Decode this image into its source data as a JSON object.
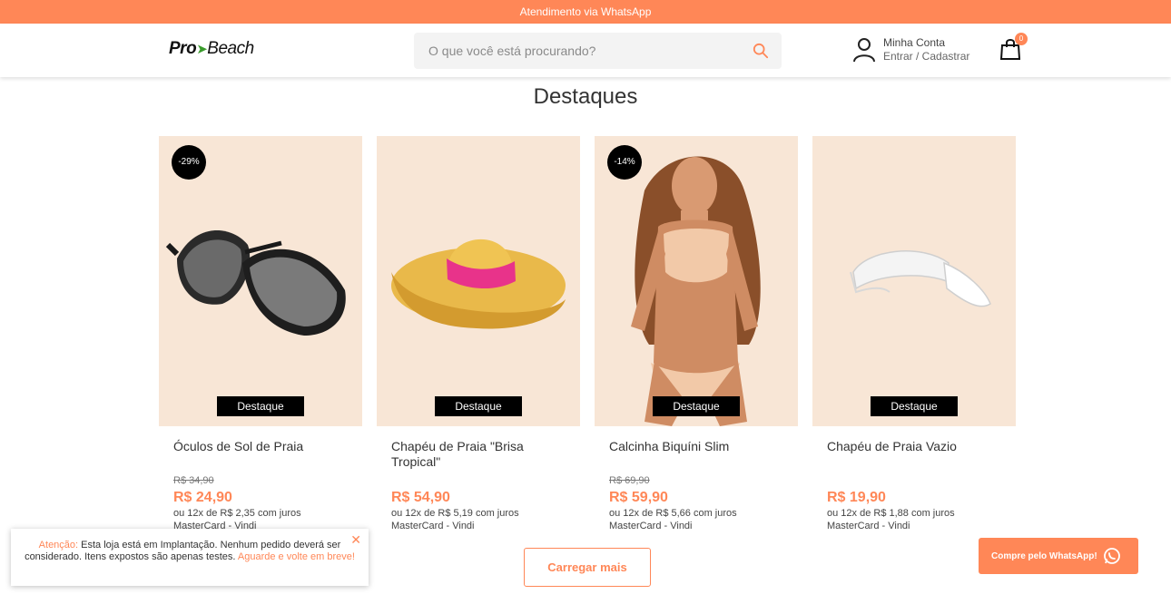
{
  "topbar": {
    "text": "Atendimento via WhatsApp"
  },
  "header": {
    "logo_pro": "Pro",
    "logo_beach": "Beach",
    "search_placeholder": "O que você está procurando?",
    "account_title": "Minha Conta",
    "account_sub": "Entrar / Cadastrar",
    "cart_count": "0"
  },
  "section": {
    "title": "Destaques"
  },
  "products": [
    {
      "name": "Óculos de Sol de Praia",
      "discount": "-29%",
      "tag": "Destaque",
      "old_price": "R$ 34,90",
      "price": "R$ 24,90",
      "installments": "ou 12x de R$ 2,35 com juros",
      "card": "MasterCard - Vindi"
    },
    {
      "name": "Chapéu de Praia \"Brisa Tropical\"",
      "discount": "",
      "tag": "Destaque",
      "old_price": "",
      "price": "R$ 54,90",
      "installments": "ou 12x de R$ 5,19 com juros",
      "card": "MasterCard - Vindi"
    },
    {
      "name": "Calcinha Biquíni Slim",
      "discount": "-14%",
      "tag": "Destaque",
      "old_price": "R$ 69,90",
      "price": "R$ 59,90",
      "installments": "ou 12x de R$ 5,66 com juros",
      "card": "MasterCard - Vindi"
    },
    {
      "name": "Chapéu de Praia Vazio",
      "discount": "",
      "tag": "Destaque",
      "old_price": "",
      "price": "R$ 19,90",
      "installments": "ou 12x de R$ 1,88 com juros",
      "card": "MasterCard - Vindi"
    }
  ],
  "load_more": "Carregar mais",
  "alert": {
    "label": "Atenção:",
    "text": "Esta loja está em Implantação. Nenhum pedido deverá ser considerado. Itens expostos são apenas testes.",
    "highlight": "Aguarde e volte em breve!",
    "close": "✕"
  },
  "whatsapp_button": "Compre pelo WhatsApp!",
  "colors": {
    "accent": "#ff8757",
    "product_bg": "#f8e6d6"
  }
}
